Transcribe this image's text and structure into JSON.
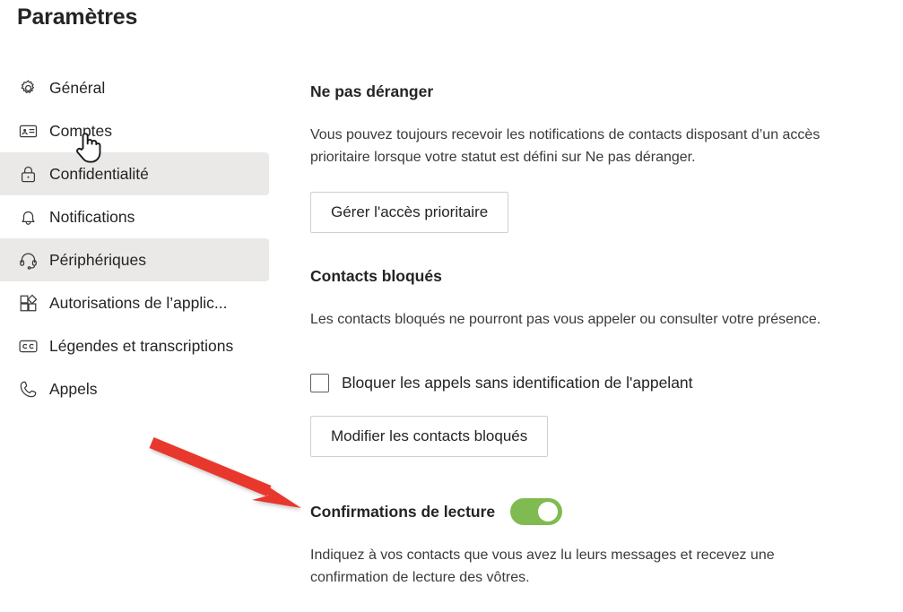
{
  "page": {
    "title": "Paramètres"
  },
  "sidebar": {
    "items": [
      {
        "label": "Général",
        "icon": "gear-icon",
        "selected": false
      },
      {
        "label": "Comptes",
        "icon": "id-card-icon",
        "selected": false
      },
      {
        "label": "Confidentialité",
        "icon": "lock-icon",
        "selected": true
      },
      {
        "label": "Notifications",
        "icon": "bell-icon",
        "selected": false
      },
      {
        "label": "Périphériques",
        "icon": "headset-icon",
        "selected": true
      },
      {
        "label": "Autorisations de l’applic...",
        "icon": "apps-grid-icon",
        "selected": false
      },
      {
        "label": "Légendes et transcriptions",
        "icon": "closed-caption-icon",
        "selected": false
      },
      {
        "label": "Appels",
        "icon": "phone-icon",
        "selected": false
      }
    ]
  },
  "main": {
    "do_not_disturb": {
      "heading": "Ne pas déranger",
      "description": "Vous pouvez toujours recevoir les notifications de contacts disposant d’un accès prioritaire lorsque votre statut est défini sur Ne pas déranger.",
      "button_label": "Gérer l'accès prioritaire"
    },
    "blocked_contacts": {
      "heading": "Contacts bloqués",
      "description": "Les contacts bloqués ne pourront pas vous appeler ou consulter votre présence.",
      "checkbox_label": "Bloquer les appels sans identification de l'appelant",
      "checkbox_checked": false,
      "button_label": "Modifier les contacts bloqués"
    },
    "read_receipts": {
      "heading": "Confirmations de lecture",
      "toggle_on": true,
      "description": "Indiquez à vos contacts que vous avez lu leurs messages et recevez une confirmation de lecture des vôtres."
    }
  },
  "annotation": {
    "arrow_color": "#e8392f",
    "cursor": "pointing-hand-cursor"
  },
  "colors": {
    "toggle_on": "#7fbb50",
    "selected_row": "#ebe9e7",
    "text_primary": "#252423",
    "text_secondary": "#3b3a39",
    "button_border": "#d2d0ce"
  }
}
